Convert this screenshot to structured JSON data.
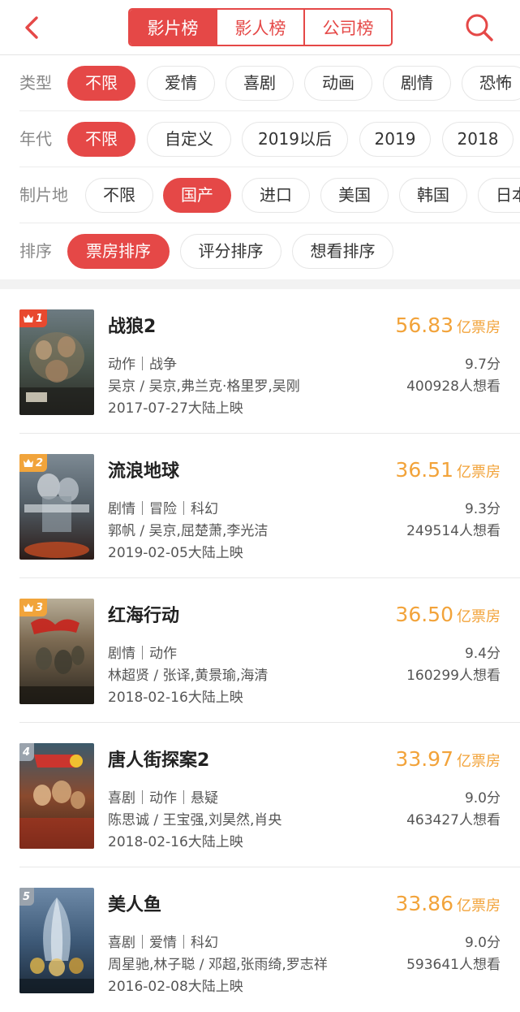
{
  "header": {
    "tabs": [
      {
        "label": "影片榜",
        "active": true
      },
      {
        "label": "影人榜",
        "active": false
      },
      {
        "label": "公司榜",
        "active": false
      }
    ],
    "back_icon": "chevron-left-icon",
    "search_icon": "search-icon"
  },
  "filters": [
    {
      "label": "类型",
      "options": [
        "不限",
        "爱情",
        "喜剧",
        "动画",
        "剧情",
        "恐怖"
      ],
      "selected": 0
    },
    {
      "label": "年代",
      "options": [
        "不限",
        "自定义",
        "2019以后",
        "2019",
        "2018"
      ],
      "selected": 0
    },
    {
      "label": "制片地",
      "options": [
        "不限",
        "国产",
        "进口",
        "美国",
        "韩国",
        "日本"
      ],
      "selected": 1
    },
    {
      "label": "排序",
      "options": [
        "票房排序",
        "评分排序",
        "想看排序"
      ],
      "selected": 0
    }
  ],
  "movies": [
    {
      "rank": "1",
      "title": "战狼2",
      "genres": "动作｜战争",
      "cast": "吴京 / 吴京,弗兰克·格里罗,吴刚",
      "release": "2017-07-27大陆上映",
      "box_office": "56.83",
      "box_unit": "亿票房",
      "score": "9.7分",
      "wish": "400928人想看"
    },
    {
      "rank": "2",
      "title": "流浪地球",
      "genres": "剧情｜冒险｜科幻",
      "cast": "郭帆 / 吴京,屈楚萧,李光洁",
      "release": "2019-02-05大陆上映",
      "box_office": "36.51",
      "box_unit": "亿票房",
      "score": "9.3分",
      "wish": "249514人想看"
    },
    {
      "rank": "3",
      "title": "红海行动",
      "genres": "剧情｜动作",
      "cast": "林超贤 / 张译,黄景瑜,海清",
      "release": "2018-02-16大陆上映",
      "box_office": "36.50",
      "box_unit": "亿票房",
      "score": "9.4分",
      "wish": "160299人想看"
    },
    {
      "rank": "4",
      "title": "唐人街探案2",
      "genres": "喜剧｜动作｜悬疑",
      "cast": "陈思诚 / 王宝强,刘昊然,肖央",
      "release": "2018-02-16大陆上映",
      "box_office": "33.97",
      "box_unit": "亿票房",
      "score": "9.0分",
      "wish": "463427人想看"
    },
    {
      "rank": "5",
      "title": "美人鱼",
      "genres": "喜剧｜爱情｜科幻",
      "cast": "周星驰,林子聪 / 邓超,张雨绮,罗志祥",
      "release": "2016-02-08大陆上映",
      "box_office": "33.86",
      "box_unit": "亿票房",
      "score": "9.0分",
      "wish": "593641人想看"
    }
  ],
  "colors": {
    "accent": "#e54847",
    "box_office": "#f2a33a",
    "rank_top3": "#e8492f",
    "rank_other": "#9aa3ad"
  }
}
